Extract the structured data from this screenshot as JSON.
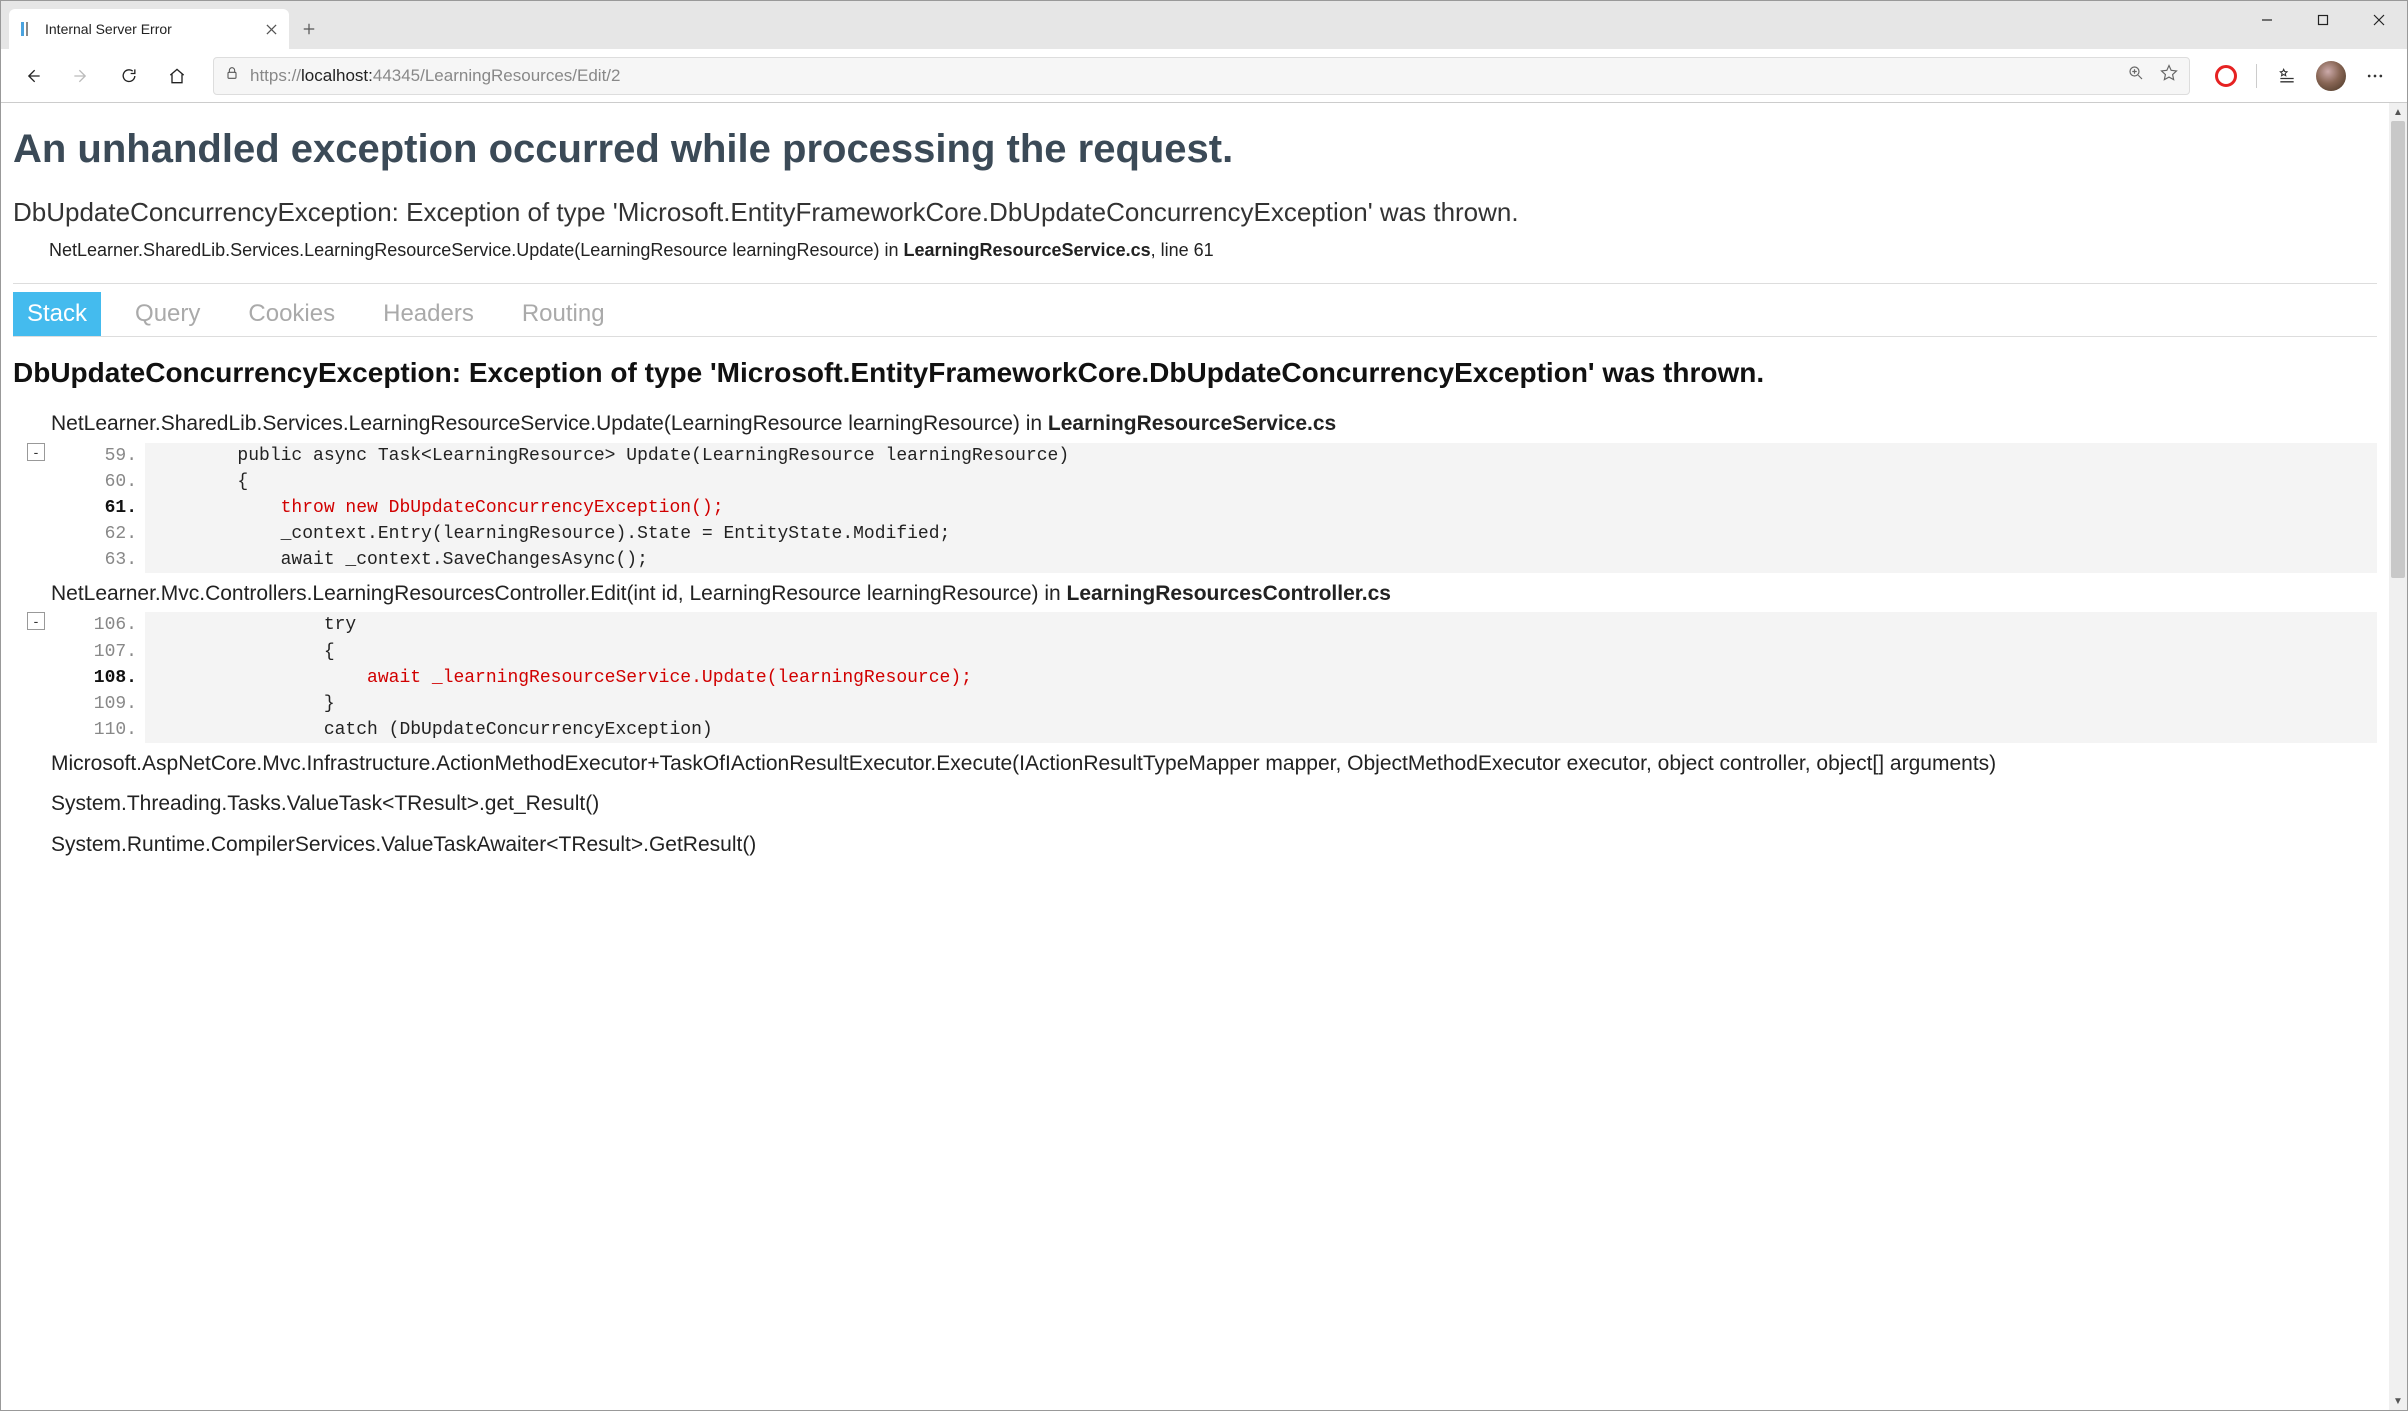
{
  "browser": {
    "tab_title": "Internal Server Error",
    "url_scheme": "https://",
    "url_host": "localhost:",
    "url_port_path": "44345/LearningResources/Edit/2"
  },
  "page": {
    "title": "An unhandled exception occurred while processing the request.",
    "exception_summary": "DbUpdateConcurrencyException: Exception of type 'Microsoft.EntityFrameworkCore.DbUpdateConcurrencyException' was thrown.",
    "exception_location_prefix": "NetLearner.SharedLib.Services.LearningResourceService.Update(LearningResource learningResource) in ",
    "exception_location_file": "LearningResourceService.cs",
    "exception_location_suffix": ", line 61",
    "tabs": [
      "Stack",
      "Query",
      "Cookies",
      "Headers",
      "Routing"
    ],
    "exception_heading": "DbUpdateConcurrencyException: Exception of type 'Microsoft.EntityFrameworkCore.DbUpdateConcurrencyException' was thrown."
  },
  "frames": [
    {
      "header_prefix": "NetLearner.SharedLib.Services.LearningResourceService.Update(LearningResource learningResource) in ",
      "header_file": "LearningResourceService.cs",
      "collapse": "-",
      "lines": [
        {
          "n": "59.",
          "hl": false,
          "err": false,
          "t": "        public async Task<LearningResource> Update(LearningResource learningResource)"
        },
        {
          "n": "60.",
          "hl": false,
          "err": false,
          "t": "        {"
        },
        {
          "n": "61.",
          "hl": true,
          "err": true,
          "t": "            throw new DbUpdateConcurrencyException();"
        },
        {
          "n": "62.",
          "hl": false,
          "err": false,
          "t": "            _context.Entry(learningResource).State = EntityState.Modified;"
        },
        {
          "n": "63.",
          "hl": false,
          "err": false,
          "t": "            await _context.SaveChangesAsync();"
        }
      ]
    },
    {
      "header_prefix": "NetLearner.Mvc.Controllers.LearningResourcesController.Edit(int id, LearningResource learningResource) in ",
      "header_file": "LearningResourcesController.cs",
      "collapse": "-",
      "lines": [
        {
          "n": "106.",
          "hl": false,
          "err": false,
          "t": "                try"
        },
        {
          "n": "107.",
          "hl": false,
          "err": false,
          "t": "                {"
        },
        {
          "n": "108.",
          "hl": true,
          "err": true,
          "t": "                    await _learningResourceService.Update(learningResource);"
        },
        {
          "n": "109.",
          "hl": false,
          "err": false,
          "t": "                }"
        },
        {
          "n": "110.",
          "hl": false,
          "err": false,
          "t": "                catch (DbUpdateConcurrencyException)"
        }
      ]
    }
  ],
  "simple_frames": [
    "Microsoft.AspNetCore.Mvc.Infrastructure.ActionMethodExecutor+TaskOfIActionResultExecutor.Execute(IActionResultTypeMapper mapper, ObjectMethodExecutor executor, object controller, object[] arguments)",
    "System.Threading.Tasks.ValueTask<TResult>.get_Result()",
    "System.Runtime.CompilerServices.ValueTaskAwaiter<TResult>.GetResult()"
  ]
}
